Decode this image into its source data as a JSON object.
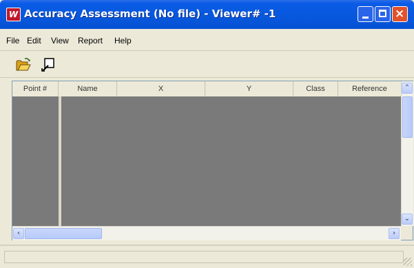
{
  "window": {
    "title": "Accuracy Assessment (No file) - Viewer# -1",
    "app_icon_letter": "W",
    "controls": {
      "minimize": "minimize-icon",
      "maximize": "maximize-icon",
      "close": "×"
    }
  },
  "menubar": {
    "items": [
      {
        "label": "File"
      },
      {
        "label": "Edit"
      },
      {
        "label": "View"
      },
      {
        "label": "Report"
      },
      {
        "label": "Help"
      }
    ]
  },
  "toolbar": {
    "buttons": [
      {
        "name": "open-file",
        "icon": "open-folder-icon"
      },
      {
        "name": "select-viewer",
        "icon": "viewer-select-icon"
      }
    ]
  },
  "table": {
    "columns": [
      "Point #",
      "Name",
      "X",
      "Y",
      "Class",
      "Reference"
    ],
    "rows": []
  },
  "statusbar": {
    "text": ""
  },
  "colors": {
    "titlebar": "#0858dc",
    "window_bg": "#ece9d8",
    "table_bg": "#7a7a7a",
    "close_button": "#e2522a",
    "app_icon": "#c2182b"
  }
}
